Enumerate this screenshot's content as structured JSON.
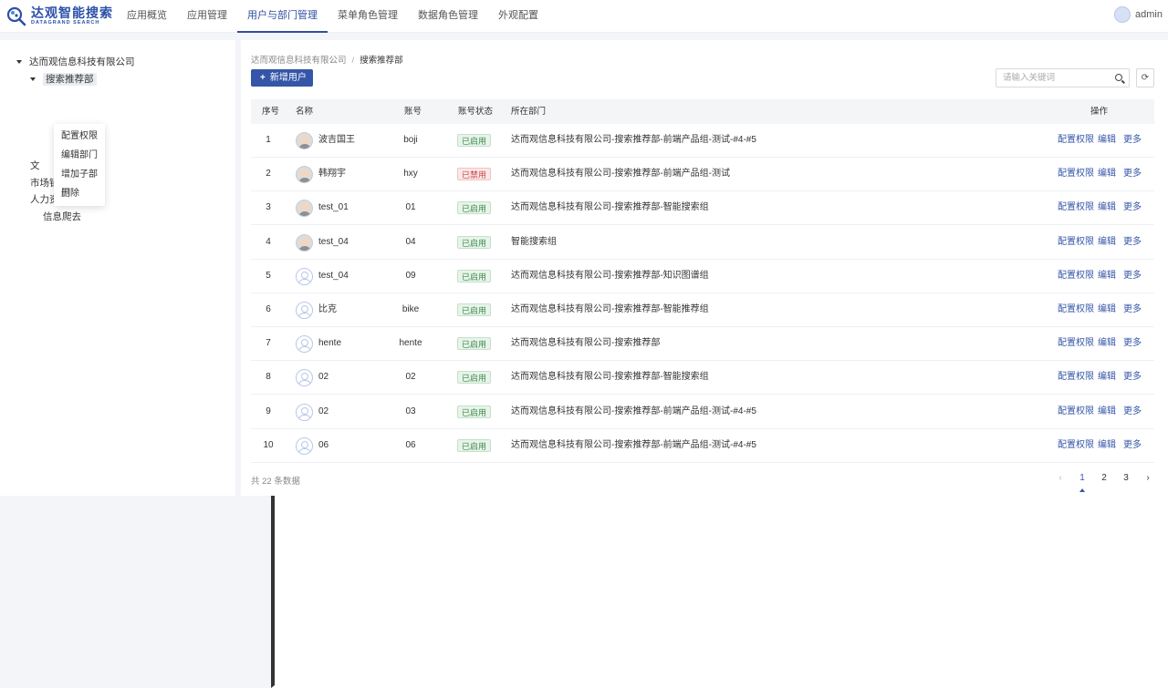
{
  "brand": {
    "name_cn": "达观智能搜索",
    "name_en": "DATAGRAND SEARCH",
    "accent": "#2f4fa0"
  },
  "nav": [
    {
      "label": "应用概览"
    },
    {
      "label": "应用管理"
    },
    {
      "label": "用户与部门管理",
      "active": true
    },
    {
      "label": "菜单角色管理"
    },
    {
      "label": "数据角色管理"
    },
    {
      "label": "外观配置"
    }
  ],
  "user": {
    "name": "admin"
  },
  "tree": {
    "root": "达而观信息科技有限公司",
    "selected": "搜索推荐部",
    "partial": "文",
    "items": [
      "市场销售部",
      "人力资源部",
      "信息爬去"
    ]
  },
  "context_menu": [
    "配置权限",
    "编辑部门",
    "增加子部门",
    "删除"
  ],
  "breadcrumb": {
    "parent": "达而观信息科技有限公司",
    "sep": "/",
    "current": "搜索推荐部"
  },
  "toolbar": {
    "add_label": "新增用户",
    "add_plus": "+",
    "search_placeholder": "请输入关键词",
    "refresh_glyph": "⟳"
  },
  "table": {
    "headers": {
      "index": "序号",
      "name": "名称",
      "account": "账号",
      "status": "账号状态",
      "dept": "所在部门",
      "ops": "操作"
    },
    "actions": [
      "配置权限",
      "编辑",
      "更多"
    ],
    "rows": [
      {
        "index": "1",
        "avatar": "photo",
        "name": "波吉国王",
        "account": "boji",
        "status": "已启用",
        "status_type": "on",
        "dept": "达而观信息科技有限公司-搜索推荐部-前端产品组-测试-#4-#5"
      },
      {
        "index": "2",
        "avatar": "photo",
        "name": "韩翔宇",
        "account": "hxy",
        "status": "已禁用",
        "status_type": "off",
        "dept": "达而观信息科技有限公司-搜索推荐部-前端产品组-测试"
      },
      {
        "index": "3",
        "avatar": "photo",
        "name": "test_01",
        "account": "01",
        "status": "已启用",
        "status_type": "on",
        "dept": "达而观信息科技有限公司-搜索推荐部-智能搜索组"
      },
      {
        "index": "4",
        "avatar": "photo",
        "name": "test_04",
        "account": "04",
        "status": "已启用",
        "status_type": "on",
        "dept": "智能搜索组"
      },
      {
        "index": "5",
        "avatar": "blank",
        "name": "test_04",
        "account": "09",
        "status": "已启用",
        "status_type": "on",
        "dept": "达而观信息科技有限公司-搜索推荐部-知识图谱组"
      },
      {
        "index": "6",
        "avatar": "blank",
        "name": "比克",
        "account": "bike",
        "status": "已启用",
        "status_type": "on",
        "dept": "达而观信息科技有限公司-搜索推荐部-智能推荐组"
      },
      {
        "index": "7",
        "avatar": "blank",
        "name": "hente",
        "account": "hente",
        "status": "已启用",
        "status_type": "on",
        "dept": "达而观信息科技有限公司-搜索推荐部"
      },
      {
        "index": "8",
        "avatar": "blank",
        "name": "02",
        "account": "02",
        "status": "已启用",
        "status_type": "on",
        "dept": "达而观信息科技有限公司-搜索推荐部-智能搜索组"
      },
      {
        "index": "9",
        "avatar": "blank",
        "name": "02",
        "account": "03",
        "status": "已启用",
        "status_type": "on",
        "dept": "达而观信息科技有限公司-搜索推荐部-前端产品组-测试-#4-#5"
      },
      {
        "index": "10",
        "avatar": "blank",
        "name": "06",
        "account": "06",
        "status": "已启用",
        "status_type": "on",
        "dept": "达而观信息科技有限公司-搜索推荐部-前端产品组-测试-#4-#5"
      }
    ]
  },
  "footer": {
    "total": "共 22 条数据"
  },
  "pagination": {
    "prev": "‹",
    "pages": [
      "1",
      "2",
      "3"
    ],
    "current": "1",
    "next": "›"
  }
}
